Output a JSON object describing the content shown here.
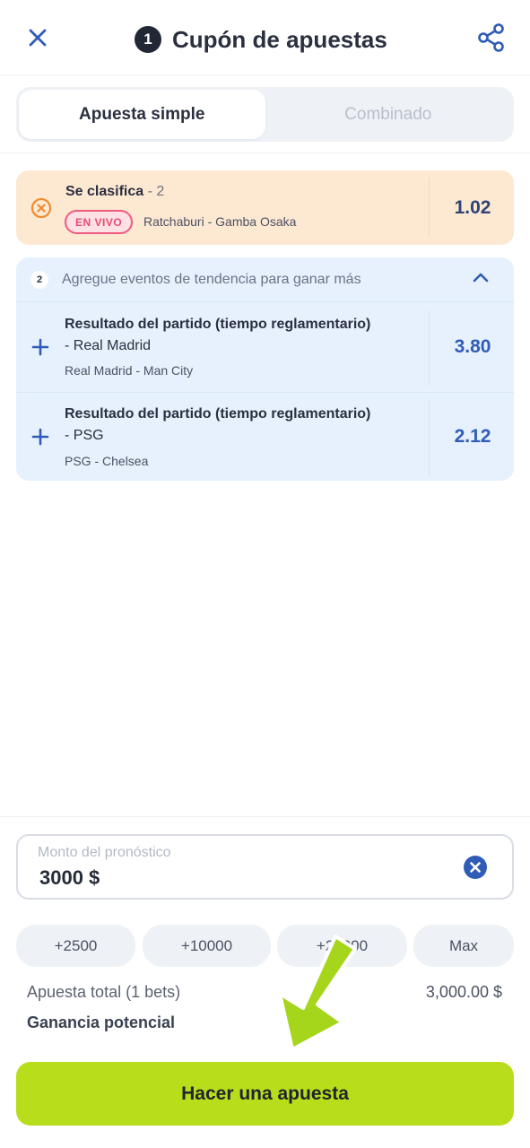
{
  "header": {
    "title": "Cupón de apuestas",
    "bet_count": "1"
  },
  "tabs": [
    {
      "label": "Apuesta simple",
      "active": true
    },
    {
      "label": "Combinado",
      "active": false
    }
  ],
  "live_bet": {
    "market": "Se clasifica",
    "separator": " - ",
    "selection": "2",
    "badge": "EN VIVO",
    "teams": "Ratchaburi - Gamba Osaka",
    "odds": "1.02"
  },
  "trending": {
    "count": "2",
    "text": "Agregue eventos de tendencia para ganar más",
    "items": [
      {
        "market_line1": "Resultado del partido (tiempo reglamentario)",
        "market_line2": "- Real Madrid",
        "teams": "Real Madrid - Man City",
        "odds": "3.80"
      },
      {
        "market_line1": "Resultado del partido (tiempo reglamentario)",
        "market_line2": "- PSG",
        "teams": "PSG - Chelsea",
        "odds": "2.12"
      }
    ]
  },
  "amount": {
    "label": "Monto del pronóstico",
    "value": "3000 $"
  },
  "quick_amounts": [
    "+2500",
    "+10000",
    "+25000",
    "Max"
  ],
  "summary": {
    "total_label": "Apuesta total (1 bets)",
    "total_value": "3,000.00 $",
    "gain_label": "Ganancia potencial"
  },
  "place_button": "Hacer una apuesta",
  "colors": {
    "accent_blue": "#2f5cb6",
    "live_card_bg": "#fde8d2",
    "trend_bg": "#e6f1fd",
    "cta_green": "#b8dd1a",
    "live_badge": "#ea4b72",
    "pointer_arrow": "#9fd41a"
  }
}
